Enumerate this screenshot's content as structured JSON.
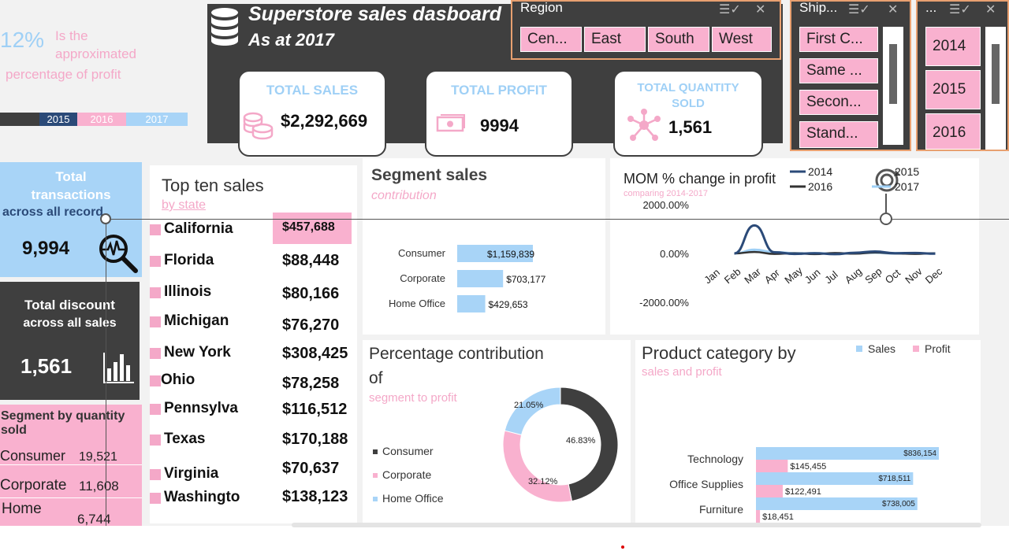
{
  "header": {
    "title": "Superstore sales dasboard",
    "subtitle": "As at 2017"
  },
  "profit_note": {
    "percent": "12%",
    "text_line1": "Is the",
    "text_line2": "approximated",
    "text_line3": "percentage of profit"
  },
  "year_bar": [
    "2015",
    "2016",
    "2017"
  ],
  "kpis": {
    "sales_label": "TOTAL SALES",
    "sales_value": "$2,292,669",
    "profit_label": "TOTAL PROFIT",
    "profit_value": "9994",
    "qty_label_1": "TOTAL QUANTITY",
    "qty_label_2": "SOLD",
    "qty_value": "1,561"
  },
  "slicers": {
    "region": {
      "title": "Region",
      "items": [
        "Cen...",
        "East",
        "South",
        "West"
      ]
    },
    "ship": {
      "title": "Ship...",
      "items": [
        "First C...",
        "Same ...",
        "Secon...",
        "Stand..."
      ]
    },
    "year": {
      "title": "...",
      "items": [
        "2014",
        "2015",
        "2016"
      ]
    }
  },
  "left": {
    "tx_line1": "Total",
    "tx_line2": "transactions",
    "tx_line3": "across all record",
    "tx_value": "9,994",
    "disc_line1": "Total discount",
    "disc_line2": "across all sales",
    "disc_value": "1,561",
    "seg_title_1": "Segment by quantity",
    "seg_title_2": "sold",
    "seg_rows": [
      {
        "name": "Consumer",
        "value": "19,521"
      },
      {
        "name": "Corporate",
        "value": "11,608"
      },
      {
        "name": "Home",
        "value": "6,744"
      }
    ]
  },
  "top_ten": {
    "title": "Top ten sales",
    "subtitle": "by state",
    "rows": [
      {
        "state": "California",
        "value": "$457,688"
      },
      {
        "state": "Florida",
        "value": "$88,448"
      },
      {
        "state": "Illinois",
        "value": "$80,166"
      },
      {
        "state": "Michigan",
        "value": "$76,270"
      },
      {
        "state": "New York",
        "value": "$308,425"
      },
      {
        "state": "Ohio",
        "value": "$78,258"
      },
      {
        "state": "Pennsylva",
        "value": "$116,512"
      },
      {
        "state": "Texas",
        "value": "$170,188"
      },
      {
        "state": "Virginia",
        "value": "$70,637"
      },
      {
        "state": "Washingto",
        "value": "$138,123"
      }
    ]
  },
  "segment_sales": {
    "title": "Segment sales",
    "subtitle": "contribution"
  },
  "mom": {
    "title": "MOM % change in profit",
    "subtitle": "comparing 2014-2017"
  },
  "donut": {
    "title_1": "Percentage contribution",
    "title_2": "of",
    "subtitle": "segment to profit"
  },
  "product": {
    "title": "Product category by",
    "subtitle": "sales and profit"
  },
  "colors": {
    "dark": "#3f3f3f",
    "pink": "#f4a8c8",
    "blue": "#9fd0f6",
    "navy": "#2b4a78"
  },
  "chart_data": [
    {
      "type": "bar",
      "id": "segment_sales",
      "categories": [
        "Consumer",
        "Corporate",
        "Home Office"
      ],
      "values": [
        1159839,
        703177,
        429653
      ],
      "labels": [
        "$1,159,839",
        "$703,177",
        "$429,653"
      ]
    },
    {
      "type": "line",
      "id": "mom",
      "x": [
        "Jan",
        "Feb",
        "Mar",
        "Apr",
        "May",
        "Jun",
        "Jul",
        "Aug",
        "Sep",
        "Oct",
        "Nov",
        "Dec"
      ],
      "ylim": [
        -2000,
        2000
      ],
      "yticks": [
        "2000.00%",
        "0.00%",
        "-2000.00%"
      ],
      "series": [
        {
          "name": "2014",
          "color": "#2b4a78",
          "values": [
            null,
            0,
            1150,
            50,
            -20,
            10,
            -30,
            30,
            80,
            10,
            20,
            -10
          ]
        },
        {
          "name": "2015",
          "color": "#9fd0f6",
          "values": [
            null,
            0,
            160,
            60,
            20,
            0,
            10,
            0,
            30,
            20,
            10,
            0
          ]
        },
        {
          "name": "2016",
          "color": "#333333",
          "values": [
            null,
            0,
            60,
            -20,
            10,
            -30,
            20,
            -10,
            40,
            0,
            -20,
            10
          ]
        },
        {
          "name": "2017",
          "color": "#9fd0f6",
          "values": [
            null,
            0,
            90,
            30,
            -10,
            20,
            0,
            10,
            20,
            -10,
            10,
            0
          ]
        }
      ]
    },
    {
      "type": "pie",
      "id": "donut",
      "categories": [
        "Consumer",
        "Corporate",
        "Home Office"
      ],
      "values": [
        46.83,
        32.12,
        21.05
      ],
      "labels": [
        "46.83%",
        "32.12%",
        "21.05%"
      ],
      "colors": [
        "#3f3f3f",
        "#f9b1cf",
        "#a8d4f7"
      ]
    },
    {
      "type": "bar",
      "id": "product",
      "categories": [
        "Technology",
        "Office Supplies",
        "Furniture"
      ],
      "series": [
        {
          "name": "Sales",
          "color": "#a8d4f7",
          "values": [
            836154,
            718511,
            738005
          ],
          "labels": [
            "$836,154",
            "$718,511",
            "$738,005"
          ]
        },
        {
          "name": "Profit",
          "color": "#f9b1cf",
          "values": [
            145455,
            122491,
            18451
          ],
          "labels": [
            "$145,455",
            "$122,491",
            "$18,451"
          ]
        }
      ]
    }
  ]
}
